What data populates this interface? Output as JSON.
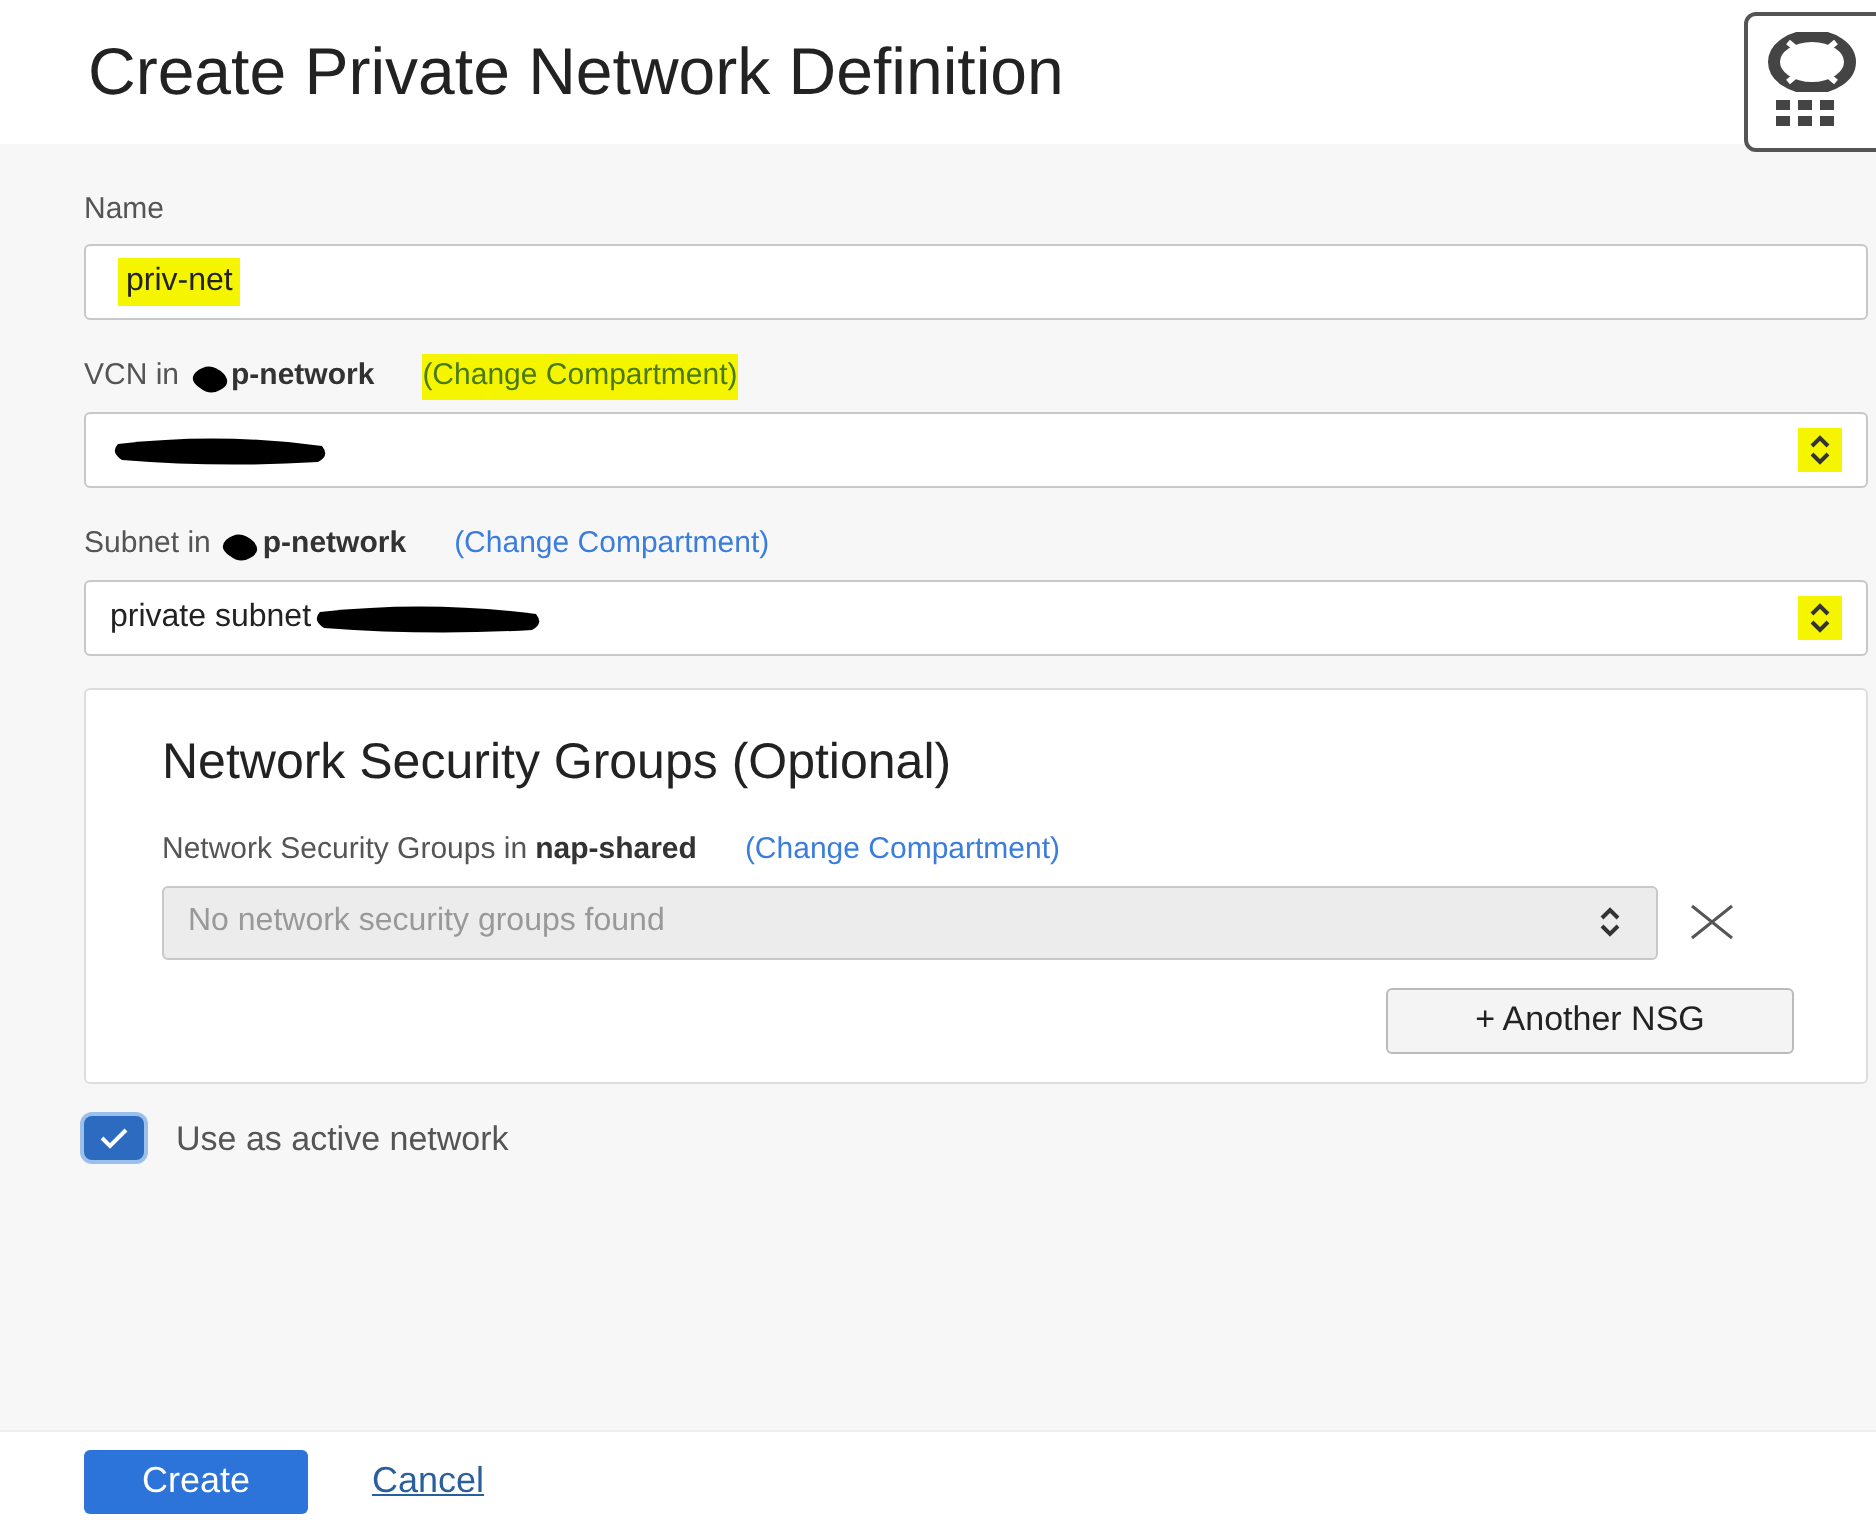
{
  "title": "Create Private Network Definition",
  "name_field": {
    "label": "Name",
    "value": "priv-net",
    "highlighted": true
  },
  "vcn": {
    "label": "VCN in",
    "compartment": "p-network",
    "redacted_compartment": true,
    "link": "(Change Compartment)",
    "link_highlighted": true,
    "redacted_value": true,
    "chevron_highlighted": true
  },
  "subnet": {
    "label": "Subnet in",
    "compartment": "p-network",
    "redacted_compartment": true,
    "link": "(Change Compartment)",
    "link_highlighted": false,
    "value": "private subnet",
    "redacted_value": true,
    "chevron_highlighted": true
  },
  "nsg": {
    "title": "Network Security Groups (Optional)",
    "label": "Network Security Groups in",
    "compartment": "nap-shared",
    "link": "(Change Compartment)",
    "placeholder": "No network security groups found",
    "disabled": true,
    "add_button": "+ Another NSG"
  },
  "active_network": {
    "label": "Use as active network",
    "checked": true
  },
  "buttons": {
    "create": "Create",
    "cancel": "Cancel"
  }
}
